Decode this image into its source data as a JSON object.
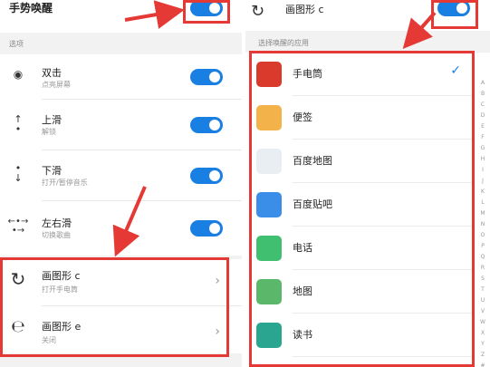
{
  "colors": {
    "accent": "#1a7fe3",
    "highlight": "#e53935"
  },
  "left": {
    "header_title": "手势唤醒",
    "section_label": "选项",
    "gestures": [
      {
        "name": "双击",
        "sub": "点亮屏幕",
        "icon": "double-tap-icon"
      },
      {
        "name": "上滑",
        "sub": "解锁",
        "icon": "swipe-up-icon"
      },
      {
        "name": "下滑",
        "sub": "打开/暂停音乐",
        "icon": "swipe-down-icon"
      },
      {
        "name": "左右滑",
        "sub": "切换歌曲",
        "icon": "swipe-left-right-icon"
      },
      {
        "name": "画图形 c",
        "sub": "打开手电筒",
        "icon": "draw-c-icon"
      },
      {
        "name": "画图形 e",
        "sub": "关闭",
        "icon": "draw-e-icon"
      }
    ]
  },
  "right": {
    "header_title": "画图形 c",
    "section_label": "选择唤醒的应用",
    "apps": [
      {
        "name": "手电筒",
        "color": "#d93a2b",
        "selected": true
      },
      {
        "name": "便签",
        "color": "#f4b24a"
      },
      {
        "name": "百度地图",
        "color": "#e9eef3"
      },
      {
        "name": "百度贴吧",
        "color": "#3b8ee8"
      },
      {
        "name": "电话",
        "color": "#3fbf6f"
      },
      {
        "name": "地图",
        "color": "#5bb86a"
      },
      {
        "name": "读书",
        "color": "#2aa58f"
      }
    ],
    "index_letters": "ABCDEFGHIJKLMNOPQRSTUVWXYZ#"
  }
}
